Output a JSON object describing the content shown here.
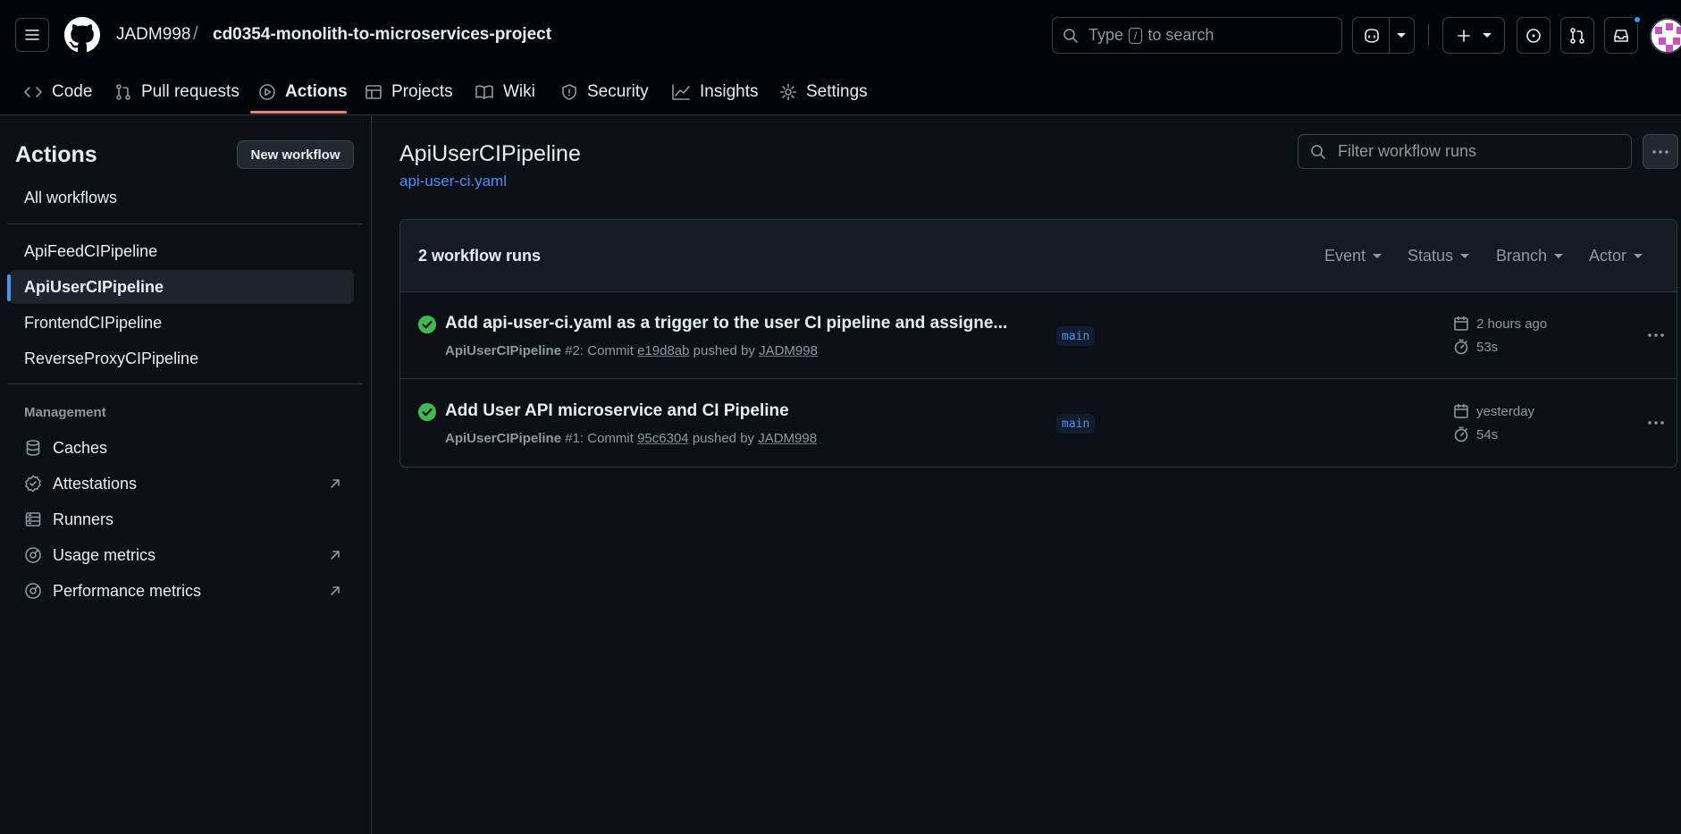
{
  "header": {
    "owner": "JADM998",
    "separator": "/",
    "repo": "cd0354-monolith-to-microservices-project",
    "search_label": "Type",
    "search_kbd": "/",
    "search_suffix": "to search"
  },
  "tabs": [
    {
      "label": "Code",
      "icon": "code-icon"
    },
    {
      "label": "Pull requests",
      "icon": "pull-request-icon"
    },
    {
      "label": "Actions",
      "icon": "play-icon",
      "active": true
    },
    {
      "label": "Projects",
      "icon": "table-icon"
    },
    {
      "label": "Wiki",
      "icon": "book-icon"
    },
    {
      "label": "Security",
      "icon": "shield-icon"
    },
    {
      "label": "Insights",
      "icon": "graph-icon"
    },
    {
      "label": "Settings",
      "icon": "gear-icon"
    }
  ],
  "sidebar": {
    "title": "Actions",
    "new_workflow": "New workflow",
    "all_workflows": "All workflows",
    "workflows": [
      "ApiFeedCIPipeline",
      "ApiUserCIPipeline",
      "FrontendCIPipeline",
      "ReverseProxyCIPipeline"
    ],
    "active_workflow": "ApiUserCIPipeline",
    "management_heading": "Management",
    "management": [
      {
        "label": "Caches",
        "icon": "database-icon"
      },
      {
        "label": "Attestations",
        "icon": "verified-icon",
        "external": true
      },
      {
        "label": "Runners",
        "icon": "server-icon"
      },
      {
        "label": "Usage metrics",
        "icon": "meter-icon",
        "external": true
      },
      {
        "label": "Performance metrics",
        "icon": "meter-icon",
        "external": true
      }
    ]
  },
  "main": {
    "workflow_title": "ApiUserCIPipeline",
    "workflow_file": "api-user-ci.yaml",
    "filter_placeholder": "Filter workflow runs",
    "runs_count": "2 workflow runs",
    "filters": [
      "Event",
      "Status",
      "Branch",
      "Actor"
    ],
    "runs": [
      {
        "title": "Add api-user-ci.yaml as a trigger to the user CI pipeline and assigne...",
        "workflow": "ApiUserCIPipeline",
        "number": "#2",
        "commit_prefix": ": Commit",
        "commit": "e19d8ab",
        "pushed_by": "pushed by",
        "actor": "JADM998",
        "branch": "main",
        "when": "2 hours ago",
        "duration": "53s",
        "status": "success"
      },
      {
        "title": "Add User API microservice and CI Pipeline",
        "workflow": "ApiUserCIPipeline",
        "number": "#1",
        "commit_prefix": ": Commit",
        "commit": "95c6304",
        "pushed_by": "pushed by",
        "actor": "JADM998",
        "branch": "main",
        "when": "yesterday",
        "duration": "54s",
        "status": "success"
      }
    ]
  },
  "colors": {
    "accent": "#4493f8",
    "success": "#3fb950",
    "tab_underline": "#f78166",
    "background": "#0d1117"
  }
}
